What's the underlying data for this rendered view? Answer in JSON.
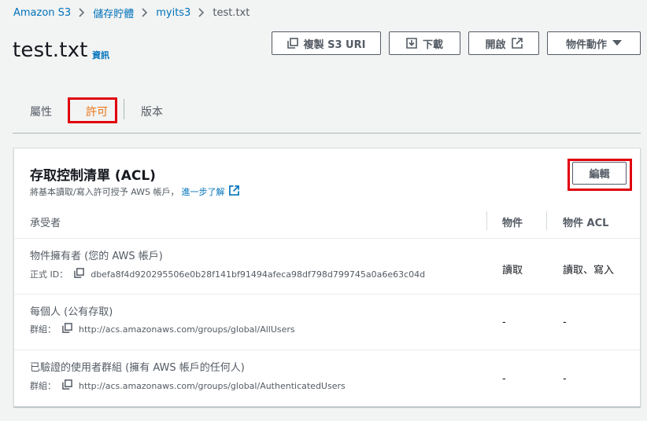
{
  "breadcrumb": [
    "Amazon S3",
    "儲存貯體",
    "myits3",
    "test.txt"
  ],
  "header": {
    "title": "test.txt",
    "info": "資訊",
    "buttons": {
      "copy": "複製 S3 URI",
      "download": "下載",
      "open": "開啟",
      "actions": "物件動作"
    }
  },
  "tabs": [
    "屬性",
    "許可",
    "版本"
  ],
  "acl": {
    "title": "存取控制清單 (ACL)",
    "desc": "將基本讀取/寫入許可授予 AWS 帳戶，",
    "learn_more": "進一步了解",
    "edit": "編輯",
    "columns": [
      "承受者",
      "物件",
      "物件 ACL"
    ],
    "rows": [
      {
        "grantee": "物件擁有者 (您的 AWS 帳戶)",
        "label": "正式 ID：",
        "value": "dbefa8f4d920295506e0b28f141bf91494afeca98df798d799745a0a6e63c04d",
        "object": "讀取",
        "object_acl": "讀取、寫入"
      },
      {
        "grantee": "每個人 (公有存取)",
        "label": "群組：",
        "value": "http://acs.amazonaws.com/groups/global/AllUsers",
        "object": "-",
        "object_acl": "-"
      },
      {
        "grantee": "已驗證的使用者群組 (擁有 AWS 帳戶的任何人)",
        "label": "群組：",
        "value": "http://acs.amazonaws.com/groups/global/AuthenticatedUsers",
        "object": "-",
        "object_acl": "-"
      }
    ]
  },
  "colors": {
    "link": "#0073bb",
    "active_tab": "#ec7211",
    "highlight": "#e0000b"
  },
  "icons": [
    "chevron-right-icon",
    "copy-icon",
    "download-icon",
    "external-link-icon",
    "caret-down-icon"
  ]
}
